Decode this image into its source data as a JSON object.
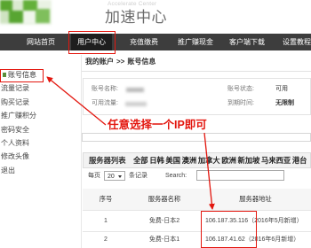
{
  "header": {
    "subtitle": "Accelerate Center",
    "title": "加速中心"
  },
  "nav": {
    "items": [
      {
        "label": "网站首页"
      },
      {
        "label": "用户中心",
        "active": true
      },
      {
        "label": "充值缴费"
      },
      {
        "label": "推广赚现金"
      },
      {
        "label": "客户端下载"
      },
      {
        "label": "设置教程"
      }
    ]
  },
  "sidebar": {
    "items": [
      {
        "label": "账号信息",
        "active": true
      },
      {
        "label": "流量记录"
      },
      {
        "label": "购买记录"
      },
      {
        "label": "推广赚积分"
      },
      {
        "label": "密码安全"
      },
      {
        "label": "个人资料"
      },
      {
        "label": "修改头像"
      },
      {
        "label": "退出"
      }
    ]
  },
  "breadcrumb": {
    "root": "我的账户",
    "separator": ">>",
    "current": "账号信息"
  },
  "account": {
    "name_label": "账号名称:",
    "status_label": "账号状态:",
    "status_value": "可用",
    "traffic_label": "可用流量:",
    "expiry_label": "到期时间:",
    "expiry_value": "无限制"
  },
  "annotation": {
    "text": "任意选择一个IP即可"
  },
  "server_list": {
    "title": "服务器列表",
    "filters": [
      "全部",
      "日韩",
      "美国",
      "澳洲",
      "加拿大",
      "欧洲",
      "新加坡",
      "马来西亚",
      "港台"
    ],
    "page_size_prefix": "每页",
    "page_size": "20",
    "page_size_suffix": "条记录",
    "search_label": "Search:",
    "columns": [
      "序号",
      "服务器名称",
      "服务器地址"
    ],
    "rows": [
      {
        "index": "1",
        "name": "免费-日本2",
        "address": "106.187.35.116",
        "note": "（2016年5月新增）"
      },
      {
        "index": "2",
        "name": "免费-日本1",
        "address": "106.187.41.62",
        "note": "（2016年6月新增）"
      }
    ]
  },
  "colors": {
    "nav_bg": "#3d3d3d",
    "nav_active_bg": "#1e1e1e",
    "annotation": "#e3160e",
    "logo_green": "#59a62f"
  }
}
